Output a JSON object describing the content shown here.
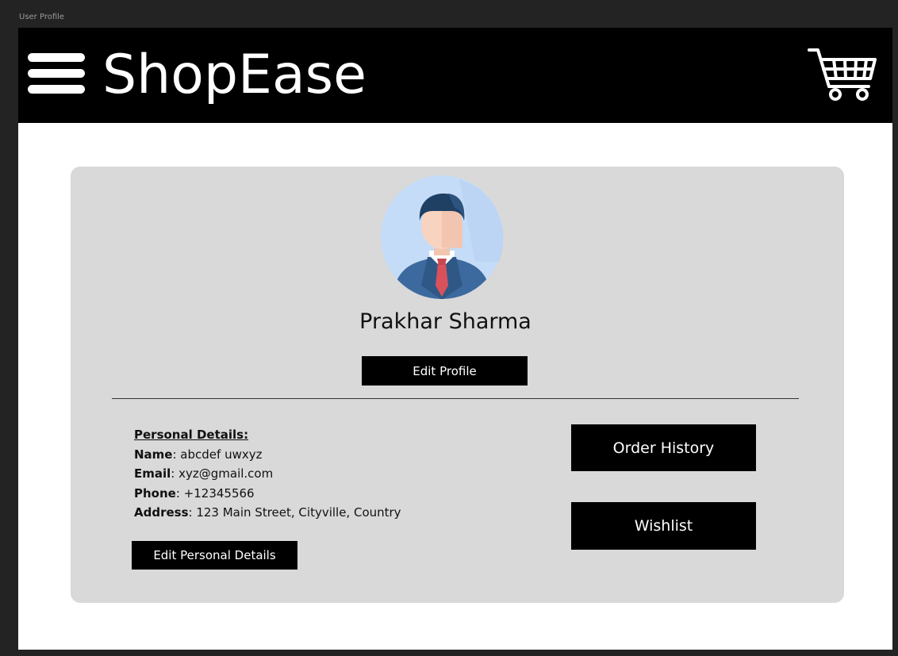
{
  "window": {
    "title": "User Profile"
  },
  "header": {
    "menu_icon": "hamburger-menu-icon",
    "brand": "ShopEase",
    "cart_icon": "shopping-cart-icon"
  },
  "profile": {
    "avatar_icon": "businessman-avatar",
    "name": "Prakhar Sharma",
    "edit_profile_label": "Edit Profile"
  },
  "personal_details": {
    "heading": "Personal Details:",
    "name_label": "Name",
    "name_value": ": abcdef uwxyz",
    "email_label": "Email",
    "email_value": ": xyz@gmail.com",
    "phone_label": "Phone",
    "phone_value": ": +12345566",
    "address_label": "Address",
    "address_value": ": 123 Main Street, Cityville, Country",
    "edit_label": "Edit Personal Details"
  },
  "actions": {
    "order_history_label": "Order History",
    "wishlist_label": "Wishlist"
  },
  "colors": {
    "header_bg": "#000000",
    "card_bg": "#d9d9d9",
    "button_bg": "#000000",
    "button_text": "#ffffff",
    "avatar_bg": "#cfe0f7"
  }
}
